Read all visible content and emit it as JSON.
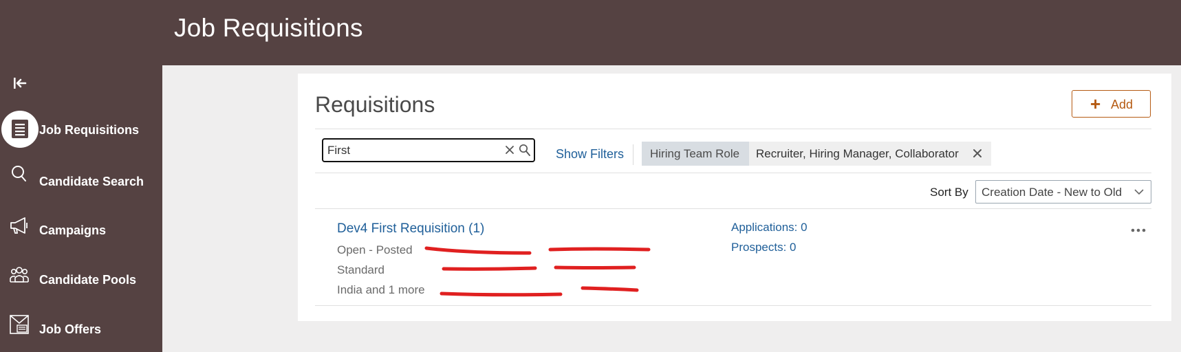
{
  "header": {
    "title": "Job Requisitions"
  },
  "sidebar": {
    "collapse_icon": "collapse-left-icon",
    "items": [
      {
        "label": "Job Requisitions",
        "icon": "document-list-icon",
        "active": true
      },
      {
        "label": "Candidate Search",
        "icon": "search-icon"
      },
      {
        "label": "Campaigns",
        "icon": "megaphone-icon"
      },
      {
        "label": "Candidate Pools",
        "icon": "people-group-icon"
      },
      {
        "label": "Job Offers",
        "icon": "offer-letter-icon"
      }
    ]
  },
  "main": {
    "title": "Requisitions",
    "add_button": {
      "label": "Add",
      "icon": "plus-icon",
      "color": "#b55a12"
    },
    "search": {
      "value": "First"
    },
    "show_filters_label": "Show Filters",
    "filter_chip": {
      "role": "Hiring Team Role",
      "value": "Recruiter, Hiring Manager, Collaborator"
    },
    "sort": {
      "label": "Sort By",
      "value": "Creation Date - New to Old"
    },
    "requisitions": [
      {
        "title": "Dev4 First Requisition (1)",
        "status": "Open - Posted",
        "type": "Standard",
        "location": "India and 1 more",
        "applications": "Applications: 0",
        "prospects": "Prospects: 0"
      }
    ]
  },
  "colors": {
    "header_bg": "#554242",
    "link": "#1f5f99",
    "accent": "#b55a12",
    "redaction": "#e02020"
  }
}
